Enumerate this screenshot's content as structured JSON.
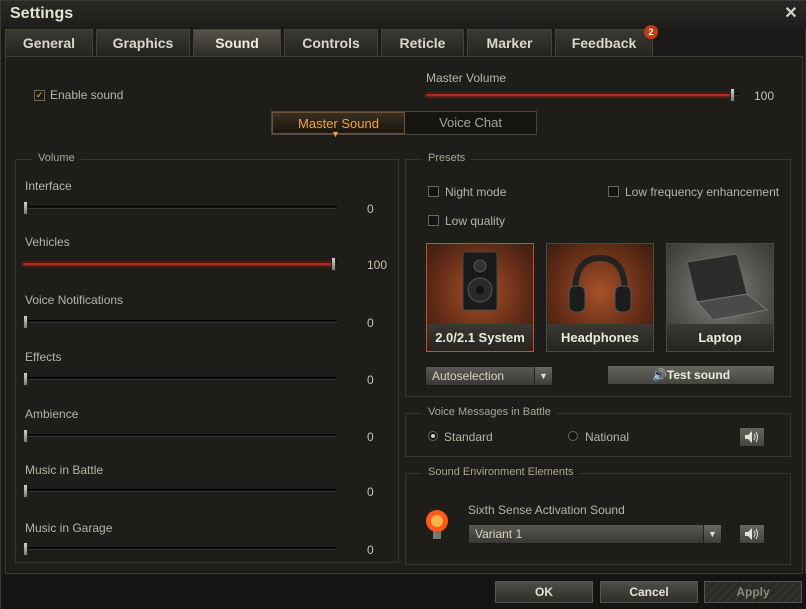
{
  "window": {
    "title": "Settings"
  },
  "tabs": [
    {
      "label": "General"
    },
    {
      "label": "Graphics"
    },
    {
      "label": "Sound"
    },
    {
      "label": "Controls"
    },
    {
      "label": "Reticle"
    },
    {
      "label": "Marker"
    },
    {
      "label": "Feedback",
      "badge": "2"
    }
  ],
  "enable_sound": {
    "label": "Enable sound",
    "checked": true
  },
  "master_volume": {
    "label": "Master Volume",
    "value": "100"
  },
  "sound_mode": {
    "options": [
      "Master Sound",
      "Voice Chat"
    ],
    "selected": "Master Sound"
  },
  "volume_panel": {
    "title": "Volume",
    "sliders": [
      {
        "label": "Interface",
        "value": "0"
      },
      {
        "label": "Vehicles",
        "value": "100"
      },
      {
        "label": "Voice Notifications",
        "value": "0"
      },
      {
        "label": "Effects",
        "value": "0"
      },
      {
        "label": "Ambience",
        "value": "0"
      },
      {
        "label": "Music in Battle",
        "value": "0"
      },
      {
        "label": "Music in Garage",
        "value": "0"
      }
    ]
  },
  "presets": {
    "title": "Presets",
    "night_mode": "Night mode",
    "low_freq": "Low frequency enhancement",
    "low_quality": "Low quality",
    "cards": [
      {
        "label": "2.0/2.1 System",
        "icon": "speaker-icon"
      },
      {
        "label": "Headphones",
        "icon": "headphones-icon"
      },
      {
        "label": "Laptop",
        "icon": "laptop-icon"
      }
    ],
    "device_select": "Autoselection",
    "test_sound": "Test sound"
  },
  "voice_messages": {
    "title": "Voice Messages in Battle",
    "options": [
      "Standard",
      "National"
    ],
    "selected": "Standard"
  },
  "environment": {
    "title": "Sound Environment Elements",
    "sixth_sense_label": "Sixth Sense Activation Sound",
    "sixth_sense_value": "Variant 1"
  },
  "footer": {
    "ok": "OK",
    "cancel": "Cancel",
    "apply": "Apply"
  },
  "colors": {
    "accent": "#f2a33a",
    "slider_fill": "#b3271d"
  }
}
